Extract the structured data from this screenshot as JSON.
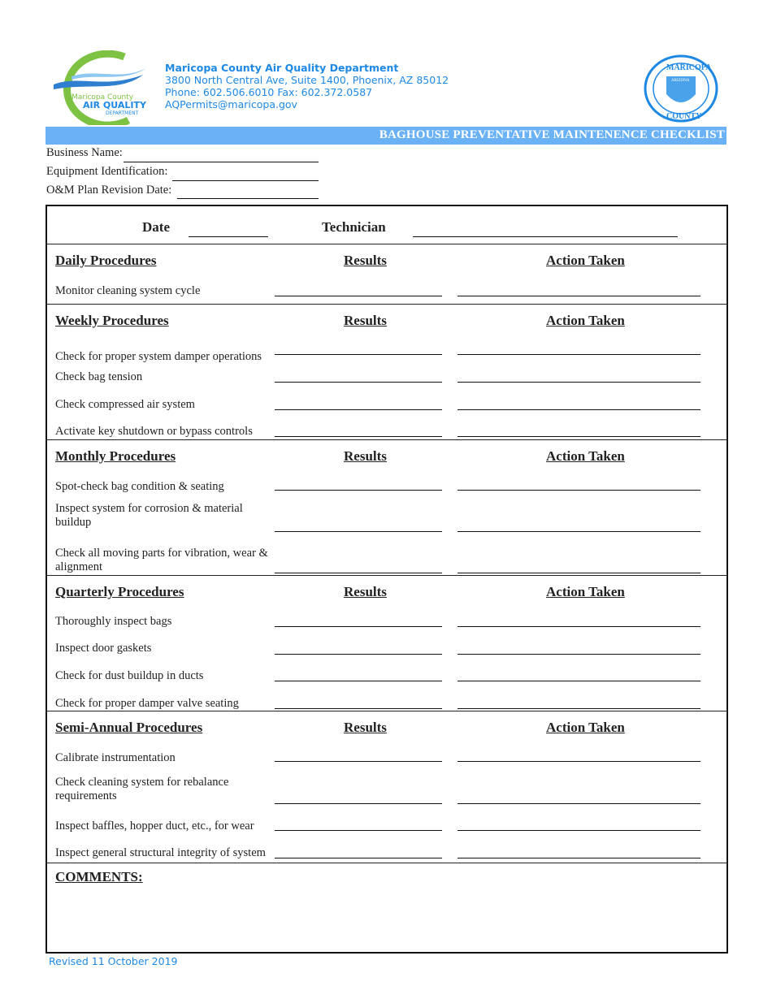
{
  "header": {
    "logo_text": [
      "Maricopa County",
      "AIR QUALITY",
      "DEPARTMENT"
    ],
    "org_name": "Maricopa County Air Quality Department",
    "address": "3800 North Central Ave, Suite 1400, Phoenix, AZ 85012",
    "phone": "Phone: 602.506.6010  Fax: 602.372.0587",
    "email": "AQPermits@maricopa.gov",
    "seal_text": [
      "MARICOPA",
      "ARIZONA",
      "COUNTY"
    ],
    "title": "BAGHOUSE PREVENTATIVE MAINTENENCE CHECKLIST",
    "band_color": "#6ab2f5"
  },
  "fields": {
    "business_name": "Business Name:",
    "equipment_id": "Equipment Identification:",
    "om_revision": "O&M Plan Revision Date:"
  },
  "table": {
    "date_label": "Date",
    "technician_label": "Technician",
    "results_label": "Results",
    "action_label": "Action Taken",
    "sections": [
      {
        "title": "Daily Procedures",
        "items": [
          "Monitor cleaning system cycle"
        ]
      },
      {
        "title": "Weekly Procedures",
        "items": [
          "Check for proper system damper operations",
          "Check bag tension",
          "Check compressed air system",
          "Activate key shutdown or bypass controls"
        ]
      },
      {
        "title": "Monthly Procedures",
        "items": [
          "Spot-check bag condition & seating",
          "Inspect system for corrosion & material buildup",
          "Check all moving parts for vibration, wear & alignment"
        ]
      },
      {
        "title": "Quarterly Procedures",
        "items": [
          "Thoroughly inspect bags",
          "Inspect door gaskets",
          "Check for dust buildup in ducts",
          "Check for proper damper valve seating"
        ]
      },
      {
        "title": "Semi-Annual Procedures",
        "items": [
          "Calibrate instrumentation",
          "Check cleaning system for rebalance requirements",
          "Inspect baffles, hopper duct, etc., for wear",
          "Inspect general structural integrity of system"
        ]
      }
    ],
    "comments_label": "COMMENTS:"
  },
  "footer": "Revised 11 October 2019"
}
